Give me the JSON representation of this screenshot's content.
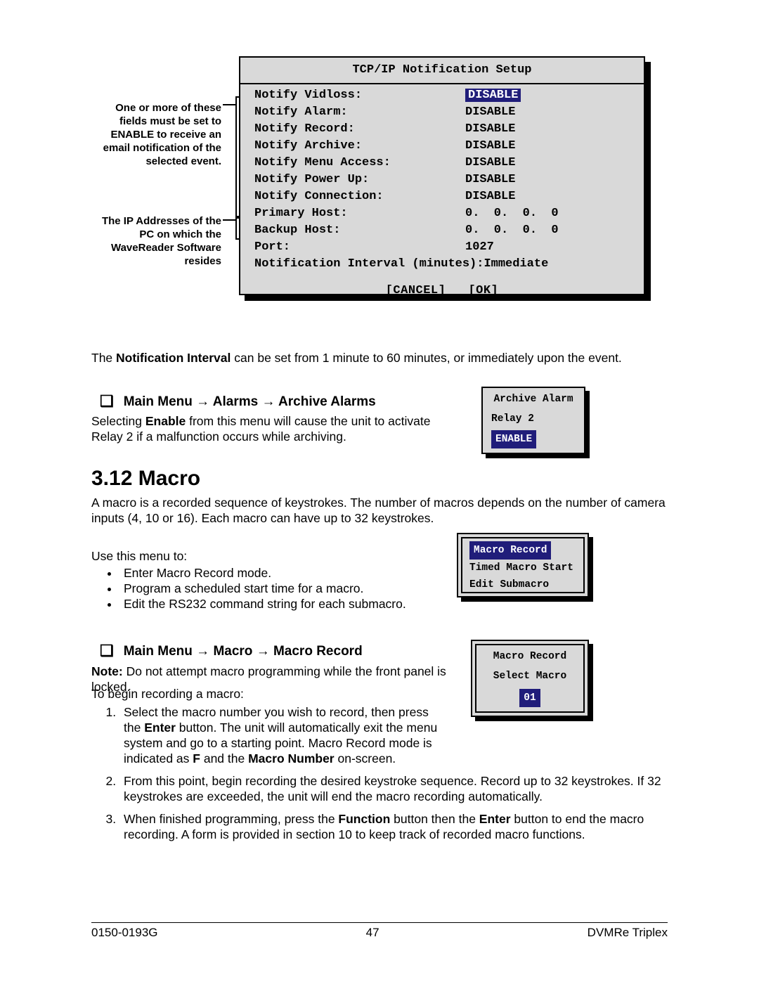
{
  "tcpip": {
    "title": "TCP/IP Notification Setup",
    "rows": [
      {
        "label": "Notify Vidloss:",
        "value": "DISABLE",
        "selected": true
      },
      {
        "label": "Notify Alarm:",
        "value": "DISABLE"
      },
      {
        "label": "Notify Record:",
        "value": "DISABLE"
      },
      {
        "label": "Notify Archive:",
        "value": "DISABLE"
      },
      {
        "label": "Notify Menu Access:",
        "value": "DISABLE"
      },
      {
        "label": "Notify Power Up:",
        "value": "DISABLE"
      },
      {
        "label": "Notify Connection:",
        "value": "DISABLE"
      },
      {
        "label": "Primary Host:",
        "value": "0.  0.  0.  0"
      },
      {
        "label": "Backup Host:",
        "value": "0.  0.  0.  0"
      },
      {
        "label": "Port:",
        "value": "1027"
      },
      {
        "label": "Notification Interval (minutes):",
        "value": "Immediate",
        "wide": true
      }
    ],
    "footer_cancel": "[CANCEL]",
    "footer_ok": "[OK]"
  },
  "annot1": "One or more of these fields must be set to ENABLE to receive an email notification of the selected event.",
  "annot2": "The IP Addresses of the PC on which the WaveReader Software resides",
  "p_after_box_pre": "The ",
  "p_after_box_bold": "Notification Interval",
  "p_after_box_post": " can be set from 1 minute to 60 minutes, or immediately upon the event.",
  "head_archive": "Main Menu → Alarms → Archive Alarms",
  "p_archive_pre": "Selecting ",
  "p_archive_bold": "Enable",
  "p_archive_post": " from this menu will cause the unit to activate Relay 2 if a malfunction occurs while archiving.",
  "archive_box": {
    "title": "Archive Alarm",
    "line2": "Relay 2",
    "line3": "ENABLE"
  },
  "sec_num": "3.12 Macro",
  "p_macro_intro": "A macro is a recorded sequence of keystrokes.  The number of macros depends on the number of camera inputs (4, 10 or 16).  Each macro can have up to 32 keystrokes.",
  "p_use_menu": "Use this menu to:",
  "bullets": [
    "Enter Macro Record mode.",
    "Program a scheduled start time for a macro.",
    "Edit the RS232 command string for each submacro."
  ],
  "macro_menu_box": {
    "l1": "Macro Record",
    "l2": "Timed Macro Start",
    "l3": "Edit Submacro"
  },
  "head_record": "Main Menu → Macro → Macro Record",
  "p_note_pre": "Note:",
  "p_note_post": "  Do not attempt macro programming while the front panel is locked.",
  "p_begin": "To begin recording a macro:",
  "record_box": {
    "l1": "Macro Record",
    "l2": "Select Macro",
    "l3": "01"
  },
  "step1_a": "Select the macro number you wish to record, then press the ",
  "step1_b": "Enter",
  "step1_c": " button.  The unit will automatically exit the menu system and go to a starting point.  Macro Record mode is indicated as ",
  "step1_d": "F",
  "step1_e": " and the ",
  "step1_f": "Macro Number",
  "step1_g": " on-screen.",
  "step2": "From this point, begin recording the desired keystroke sequence.  Record up to 32 keystrokes.  If 32 keystrokes are exceeded, the unit will end the macro recording automatically.",
  "step3_a": "When finished programming, press the ",
  "step3_b": "Function",
  "step3_c": " button then the ",
  "step3_d": "Enter",
  "step3_e": " button to end the macro recording.  A form is provided in section 10 to keep track of recorded macro functions.",
  "footer": {
    "left": "0150-0193G",
    "center": "47",
    "right": "DVMRe Triplex"
  }
}
